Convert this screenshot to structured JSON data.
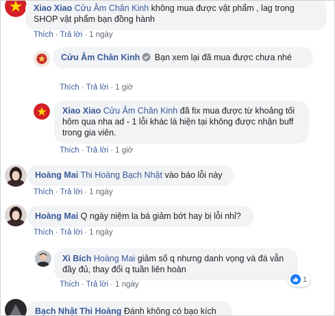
{
  "labels": {
    "like": "Thích",
    "reply": "Trả lời",
    "dot": "·"
  },
  "comments": [
    {
      "author": "Xiao Xiao",
      "mention": "Cửu Âm Chân Kinh",
      "text": " không mua được vật phẩm , lag trong SHOP vật phẩm bạn đồng hành",
      "time": "1 ngày",
      "avatar": "vietnam-flag"
    },
    {
      "author": "Cửu Âm Chân Kinh",
      "verified": true,
      "text": "Bạn xem lại đã mua được chưa nhé",
      "time": "1 giờ",
      "avatar": "vietnam-flag"
    },
    {
      "author": "Xiao Xiao",
      "mention": "Cửu Âm Chân Kinh",
      "text": " đã fix mua được từ khoảng tối hôm qua nha ad - 1 lỗi khác là hiện tại không được nhận buff trong gia viên.",
      "time": "1 giờ",
      "avatar": "vietnam-flag"
    },
    {
      "author": "Hoàng Mai",
      "mention": "Thi Hoàng Bạch Nhật",
      "text": " vào báo lỗi này",
      "time": "1 ngày",
      "avatar": "girl-photo"
    },
    {
      "author": "Hoàng Mai",
      "text": " Q ngày niệm la bá giảm bớt hay bị lỗi nhỉ?",
      "time": "1 ngày",
      "avatar": "girl-photo"
    },
    {
      "author": "Xì Bích",
      "mention": "Hoàng Mai",
      "text": " giảm số q nhưng danh vọng và đá vẫn đầy đủ, thay đổi q tuần liên hoàn",
      "time": "1 ngày",
      "avatar": "man-photo",
      "reaction_count": "1"
    },
    {
      "author": "Bạch Nhật Thi Hoàng",
      "text": " Đánh không có bạo kích",
      "avatar": "dark-photo"
    }
  ]
}
